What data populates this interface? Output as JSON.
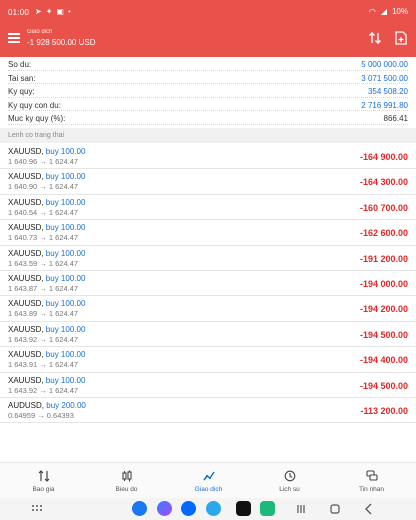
{
  "status": {
    "time": "01:00",
    "battery": "10%"
  },
  "header": {
    "title": "Giao dich",
    "subtitle": "-1 928 500.00 USD"
  },
  "summary": [
    {
      "label": "So du:",
      "value": "5 000 000.00",
      "color": "blue"
    },
    {
      "label": "Tai san:",
      "value": "3 071 500.00",
      "color": "blue"
    },
    {
      "label": "Ky quy:",
      "value": "354 508.20",
      "color": "blue"
    },
    {
      "label": "Ky quy con du:",
      "value": "2 716 991.80",
      "color": "blue"
    },
    {
      "label": "Muc ky quy (%):",
      "value": "866.41",
      "color": "dark"
    }
  ],
  "section_title": "Lenh co trang thai",
  "orders": [
    {
      "symbol": "XAUUSD,",
      "side": "buy 100.00",
      "prices": "1 640.96 → 1 624.47",
      "pl": "-164 900.00"
    },
    {
      "symbol": "XAUUSD,",
      "side": "buy 100.00",
      "prices": "1 640.90 → 1 624.47",
      "pl": "-164 300.00"
    },
    {
      "symbol": "XAUUSD,",
      "side": "buy 100.00",
      "prices": "1 640.54 → 1 624.47",
      "pl": "-160 700.00"
    },
    {
      "symbol": "XAUUSD,",
      "side": "buy 100.00",
      "prices": "1 640.73 → 1 624.47",
      "pl": "-162 600.00"
    },
    {
      "symbol": "XAUUSD,",
      "side": "buy 100.00",
      "prices": "1 643.59 → 1 624.47",
      "pl": "-191 200.00"
    },
    {
      "symbol": "XAUUSD,",
      "side": "buy 100.00",
      "prices": "1 643.87 → 1 624.47",
      "pl": "-194 000.00"
    },
    {
      "symbol": "XAUUSD,",
      "side": "buy 100.00",
      "prices": "1 643.89 → 1 624.47",
      "pl": "-194 200.00"
    },
    {
      "symbol": "XAUUSD,",
      "side": "buy 100.00",
      "prices": "1 643.92 → 1 624.47",
      "pl": "-194 500.00"
    },
    {
      "symbol": "XAUUSD,",
      "side": "buy 100.00",
      "prices": "1 643.91 → 1 624.47",
      "pl": "-194 400.00"
    },
    {
      "symbol": "XAUUSD,",
      "side": "buy 100.00",
      "prices": "1 643.92 → 1 624.47",
      "pl": "-194 500.00"
    },
    {
      "symbol": "AUDUSD,",
      "side": "buy 200.00",
      "prices": "0.64959 → 0.64393",
      "pl": "-113 200.00"
    }
  ],
  "nav": [
    {
      "label": "Bao gia",
      "icon": "arrows-updown-icon"
    },
    {
      "label": "Bieu do",
      "icon": "candles-icon"
    },
    {
      "label": "Giao dich",
      "icon": "trend-line-icon"
    },
    {
      "label": "Lich su",
      "icon": "history-icon"
    },
    {
      "label": "Tin nhan",
      "icon": "chat-icon"
    }
  ],
  "colors": {
    "header": "#e8524a",
    "accent": "#1a6fd1",
    "loss": "#e02828"
  }
}
